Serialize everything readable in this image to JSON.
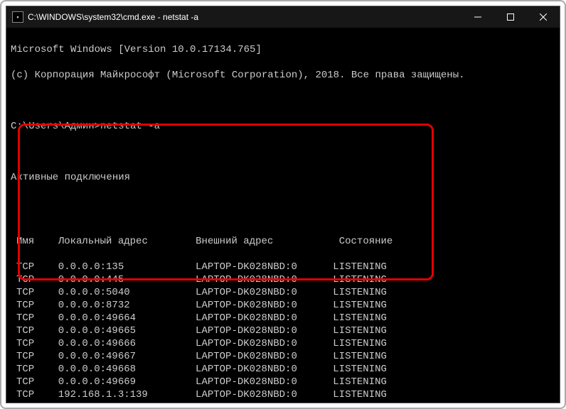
{
  "window": {
    "title": "C:\\WINDOWS\\system32\\cmd.exe - netstat  -a"
  },
  "terminal": {
    "banner_line1": "Microsoft Windows [Version 10.0.17134.765]",
    "banner_line2": "(c) Корпорация Майкрософт (Microsoft Corporation), 2018. Все права защищены.",
    "prompt_line": "C:\\Users\\Админ>netstat -a",
    "active_label": "Активные подключения",
    "headers": {
      "name": "Имя",
      "local": "Локальный адрес",
      "remote": "Внешний адрес",
      "state": "Состояние"
    },
    "rows": [
      {
        "proto": "TCP",
        "local": "0.0.0.0:135",
        "remote": "LAPTOP-DK028NBD:0",
        "state": "LISTENING"
      },
      {
        "proto": "TCP",
        "local": "0.0.0.0:445",
        "remote": "LAPTOP-DK028NBD:0",
        "state": "LISTENING"
      },
      {
        "proto": "TCP",
        "local": "0.0.0.0:5040",
        "remote": "LAPTOP-DK028NBD:0",
        "state": "LISTENING"
      },
      {
        "proto": "TCP",
        "local": "0.0.0.0:8732",
        "remote": "LAPTOP-DK028NBD:0",
        "state": "LISTENING"
      },
      {
        "proto": "TCP",
        "local": "0.0.0.0:49664",
        "remote": "LAPTOP-DK028NBD:0",
        "state": "LISTENING"
      },
      {
        "proto": "TCP",
        "local": "0.0.0.0:49665",
        "remote": "LAPTOP-DK028NBD:0",
        "state": "LISTENING"
      },
      {
        "proto": "TCP",
        "local": "0.0.0.0:49666",
        "remote": "LAPTOP-DK028NBD:0",
        "state": "LISTENING"
      },
      {
        "proto": "TCP",
        "local": "0.0.0.0:49667",
        "remote": "LAPTOP-DK028NBD:0",
        "state": "LISTENING"
      },
      {
        "proto": "TCP",
        "local": "0.0.0.0:49668",
        "remote": "LAPTOP-DK028NBD:0",
        "state": "LISTENING"
      },
      {
        "proto": "TCP",
        "local": "0.0.0.0:49669",
        "remote": "LAPTOP-DK028NBD:0",
        "state": "LISTENING"
      },
      {
        "proto": "TCP",
        "local": "192.168.1.3:139",
        "remote": "LAPTOP-DK028NBD:0",
        "state": "LISTENING"
      }
    ]
  }
}
